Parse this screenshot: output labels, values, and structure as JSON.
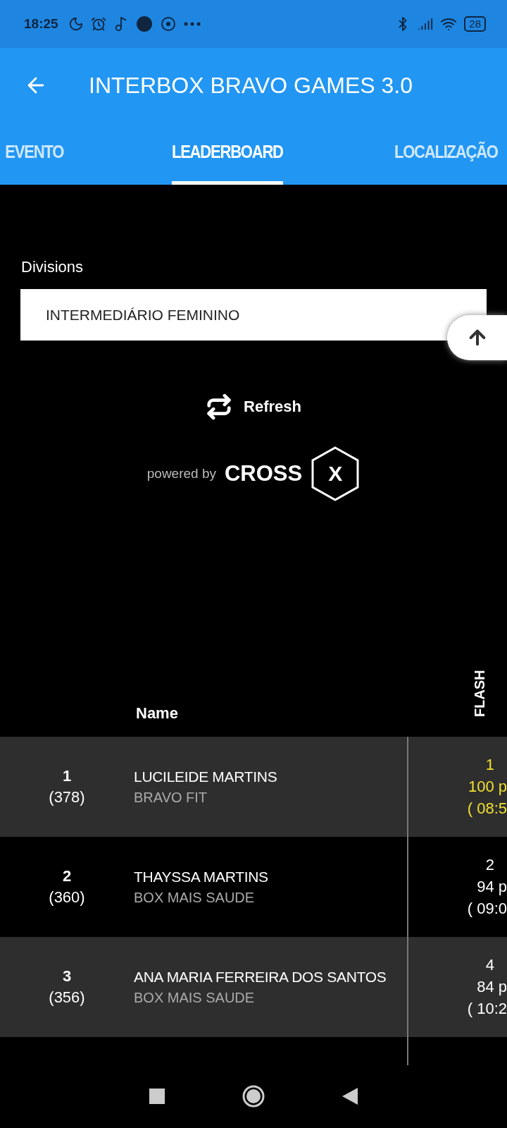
{
  "status_bar": {
    "time": "18:25",
    "battery": "28"
  },
  "app_bar": {
    "title": "INTERBOX BRAVO GAMES 3.0"
  },
  "tabs": [
    {
      "label": "EVENTO",
      "selected": false
    },
    {
      "label": "LEADERBOARD",
      "selected": true
    },
    {
      "label": "LOCALIZAÇÃO",
      "selected": false
    }
  ],
  "divisions": {
    "label": "Divisions",
    "value": "INTERMEDIÁRIO FEMININO"
  },
  "refresh": {
    "label": "Refresh"
  },
  "powered_by": {
    "label": "powered by",
    "brand": "CROSS",
    "mark": "X"
  },
  "table": {
    "columns": [
      {
        "label": "Name"
      },
      {
        "label": "FLASH"
      }
    ],
    "rows": [
      {
        "rank": "1",
        "points": "(378)",
        "name": "LUCILEIDE MARTINS",
        "box": "BRAVO FIT",
        "score": [
          "1",
          "100 p",
          "( 08:5"
        ],
        "highlight": true
      },
      {
        "rank": "2",
        "points": "(360)",
        "name": "THAYSSA MARTINS",
        "box": "BOX MAIS SAUDE",
        "score": [
          "2",
          "94 p",
          "( 09:0"
        ],
        "highlight": false
      },
      {
        "rank": "3",
        "points": "(356)",
        "name": "ANA MARIA FERREIRA DOS SANTOS",
        "box": "BOX MAIS SAUDE",
        "score": [
          "4",
          "84 p",
          "( 10:2"
        ],
        "highlight": false
      }
    ]
  }
}
